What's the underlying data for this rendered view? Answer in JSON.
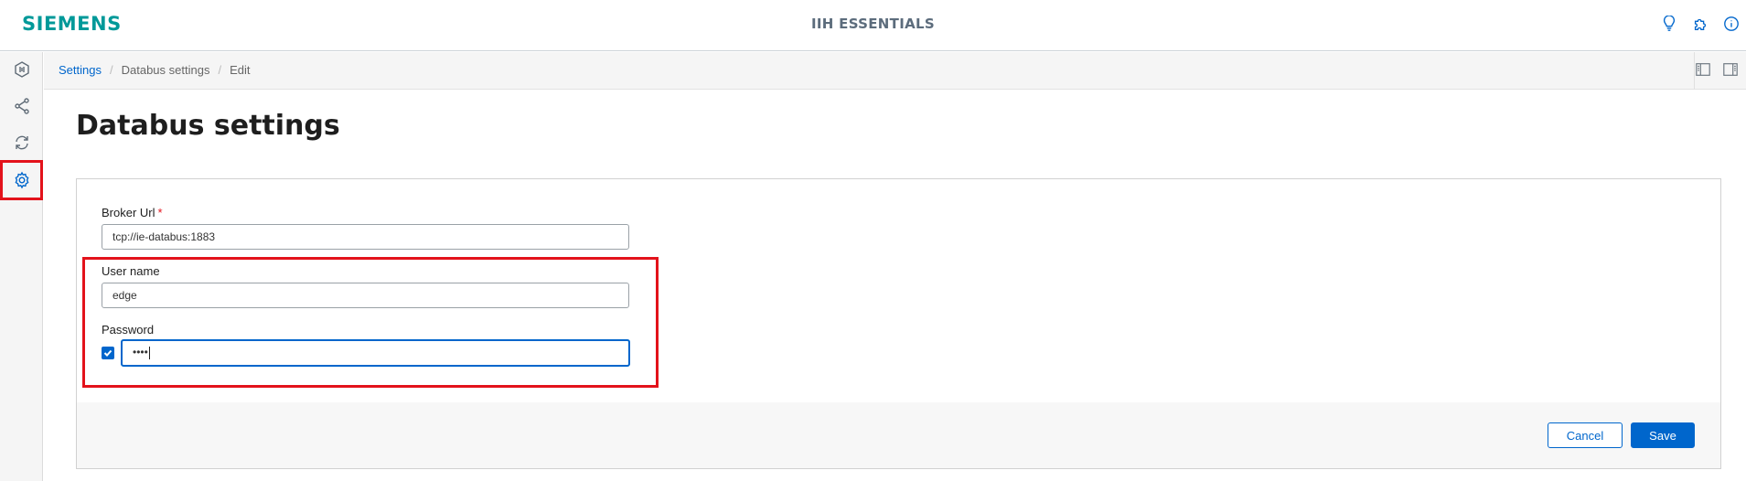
{
  "header": {
    "brand": "SIEMENS",
    "app_title": "IIH ESSENTIALS",
    "icons": [
      "lightbulb-icon",
      "puzzle-icon",
      "info-icon"
    ]
  },
  "sidebar": {
    "items": [
      {
        "icon": "hexagon-connector-icon",
        "active": false
      },
      {
        "icon": "share-nodes-icon",
        "active": false
      },
      {
        "icon": "sync-icon",
        "active": false
      },
      {
        "icon": "gear-icon",
        "active": true
      }
    ]
  },
  "breadcrumb": {
    "items": [
      "Settings",
      "Databus settings",
      "Edit"
    ]
  },
  "page": {
    "title": "Databus settings"
  },
  "form": {
    "broker_url": {
      "label": "Broker Url",
      "required_marker": "*",
      "value": "tcp://ie-databus:1883"
    },
    "username": {
      "label": "User name",
      "value": "edge"
    },
    "password": {
      "label": "Password",
      "masked_value": "••••",
      "checkbox_checked": true
    }
  },
  "actions": {
    "cancel_label": "Cancel",
    "save_label": "Save"
  },
  "colors": {
    "brand": "#009999",
    "accent": "#0066cc",
    "highlight": "#e3121b"
  }
}
